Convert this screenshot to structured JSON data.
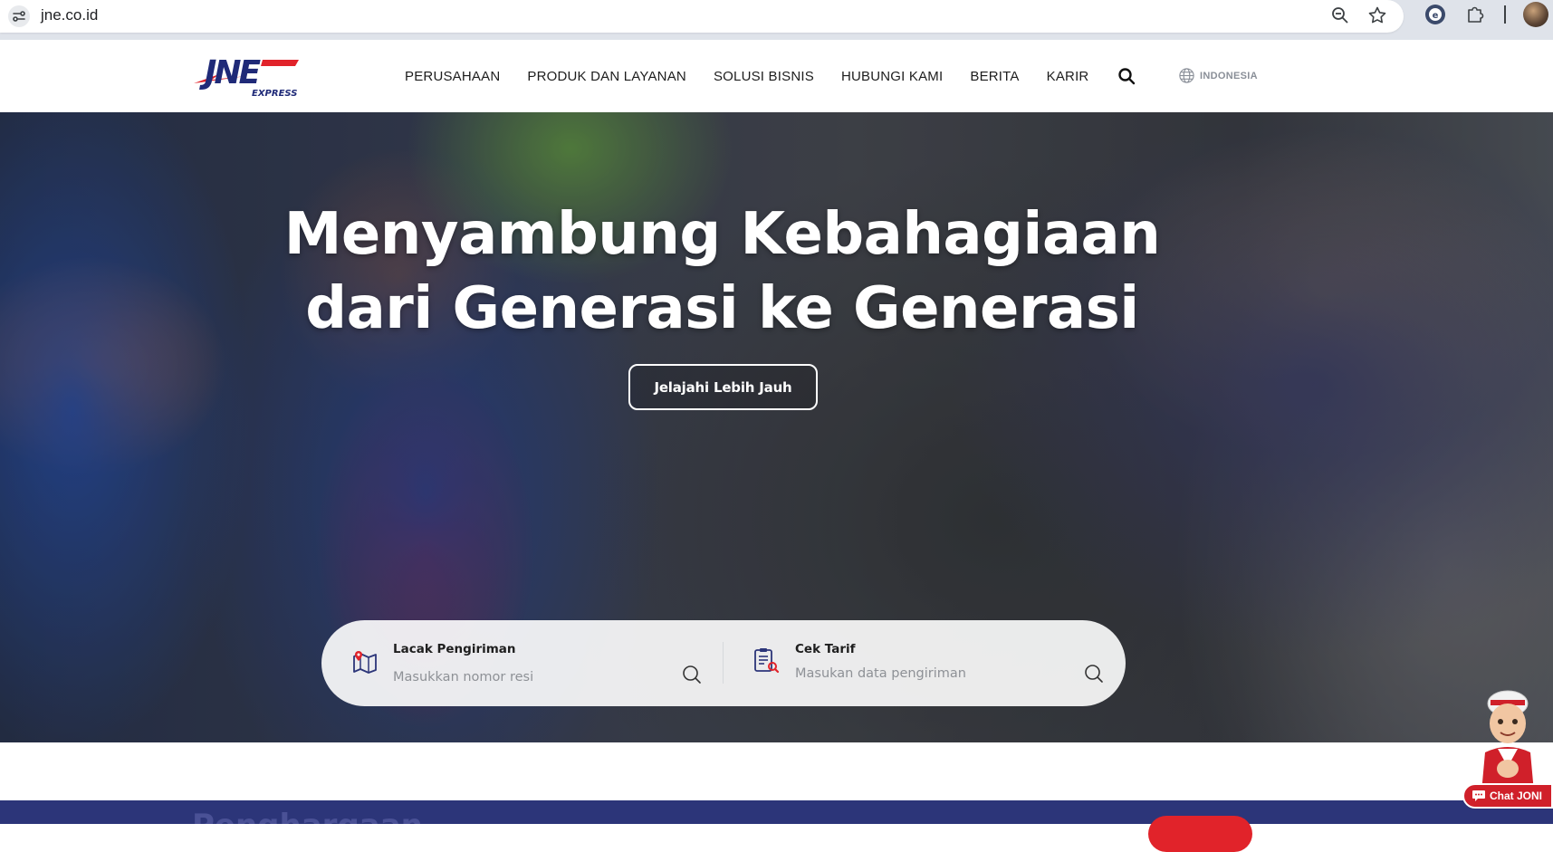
{
  "browser": {
    "url": "jne.co.id"
  },
  "header": {
    "logo_text": "JNE",
    "logo_subtext": "EXPRESS",
    "nav": [
      {
        "label": "PERUSAHAAN"
      },
      {
        "label": "PRODUK DAN LAYANAN"
      },
      {
        "label": "SOLUSI BISNIS"
      },
      {
        "label": "HUBUNGI KAMI"
      },
      {
        "label": "BERITA"
      },
      {
        "label": "KARIR"
      }
    ],
    "language": "INDONESIA"
  },
  "hero": {
    "title_line1": "Menyambung Kebahagiaan",
    "title_line2": "dari Generasi ke Generasi",
    "cta_label": "Jelajahi Lebih Jauh"
  },
  "tools": {
    "track": {
      "label": "Lacak Pengiriman",
      "value": "",
      "placeholder": "Masukkan nomor resi"
    },
    "tariff": {
      "label": "Cek Tarif",
      "value": "",
      "placeholder": "Masukan data pengiriman"
    }
  },
  "section": {
    "heading": "Penghargaan"
  },
  "chat": {
    "label": "Chat JONI"
  },
  "colors": {
    "brand_navy": "#2c3579",
    "brand_red": "#e1232a",
    "logo_blue": "#1f2a78"
  }
}
